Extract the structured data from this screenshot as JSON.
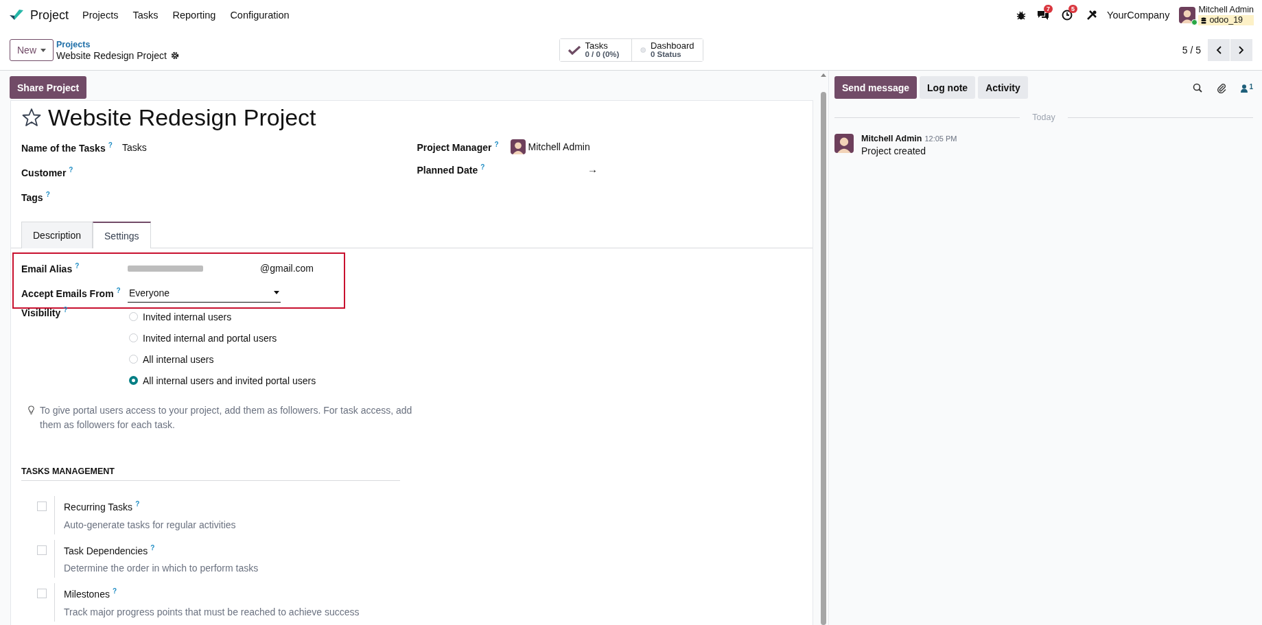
{
  "navbar": {
    "app_name": "Project",
    "menu": [
      "Projects",
      "Tasks",
      "Reporting",
      "Configuration"
    ],
    "chat_badge": "7",
    "activity_badge": "5",
    "company": "YourCompany",
    "user_name": "Mitchell Admin",
    "database": "odoo_19"
  },
  "control_panel": {
    "new_button": "New",
    "breadcrumb_parent": "Projects",
    "breadcrumb_current": "Website Redesign Project",
    "smart_buttons": [
      {
        "kind": "tasks",
        "label": "Tasks",
        "value": "0 / 0 (0%)"
      },
      {
        "kind": "status",
        "label": "Dashboard",
        "value": "0 Status"
      }
    ],
    "pager": "5 / 5"
  },
  "form": {
    "action_buttons": [
      "Share Project"
    ],
    "favorite": false,
    "title": "Website Redesign Project",
    "fields_left": [
      {
        "label": "Name of the Tasks",
        "help": "?",
        "value": "Tasks"
      },
      {
        "label": "Customer",
        "help": "?"
      },
      {
        "label": "Tags",
        "help": "?"
      }
    ],
    "fields_right": [
      {
        "kind": "user",
        "label": "Project Manager",
        "help": "?",
        "value": "Mitchell Admin"
      },
      {
        "kind": "daterange",
        "label": "Planned Date",
        "help": "?",
        "value": "→"
      }
    ],
    "tabs": [
      {
        "label": "Description",
        "selected": false
      },
      {
        "label": "Settings",
        "selected": true
      }
    ],
    "settings": {
      "email_alias": {
        "label": "Email Alias",
        "help": "?",
        "domain": "@gmail.com"
      },
      "accept_emails": {
        "label": "Accept Emails From",
        "help": "?",
        "value": "Everyone"
      },
      "visibility": {
        "label": "Visibility",
        "help": "?",
        "options": [
          {
            "label": "Invited internal users",
            "selected": false
          },
          {
            "label": "Invited internal and portal users",
            "selected": false
          },
          {
            "label": "All internal users",
            "selected": false
          },
          {
            "label": "All internal users and invited portal users",
            "selected": true
          }
        ]
      },
      "hint": "To give portal users access to your project, add them as followers. For task access, add them as followers for each task.",
      "section_title": "TASKS MANAGEMENT",
      "features": [
        {
          "title": "Recurring Tasks",
          "help": "?",
          "description": "Auto-generate tasks for regular activities",
          "checked": false
        },
        {
          "title": "Task Dependencies",
          "help": "?",
          "description": "Determine the order in which to perform tasks",
          "checked": false
        },
        {
          "title": "Milestones",
          "help": "?",
          "description": "Track major progress points that must be reached to achieve success",
          "checked": false
        }
      ]
    }
  },
  "chatter": {
    "buttons": [
      {
        "label": "Send message",
        "primary": true
      },
      {
        "label": "Log note",
        "primary": false
      },
      {
        "label": "Activity",
        "primary": false
      }
    ],
    "followers_count": "1",
    "date_separator": "Today",
    "messages": [
      {
        "author": "Mitchell Admin",
        "time": "12:05 PM",
        "body": "Project created"
      }
    ]
  }
}
